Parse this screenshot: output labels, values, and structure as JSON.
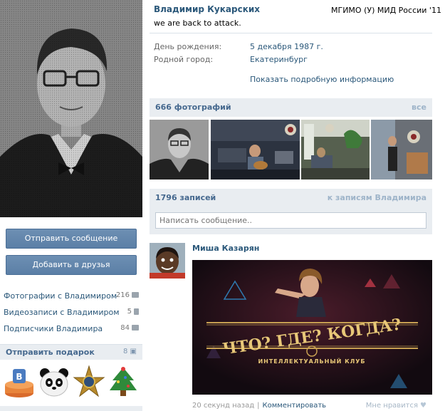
{
  "profile": {
    "name": "Владимир Кукарских",
    "university": "МГИМО (У) МИД России '11",
    "status": "we are back to attack.",
    "info": {
      "birthday_label": "День рождения:",
      "birthday_value": "5 декабря 1987 г.",
      "city_label": "Родной город:",
      "city_value": "Екатеринбург",
      "more_link": "Показать подробную информацию"
    }
  },
  "actions": {
    "send_message": "Отправить сообщение",
    "add_friend": "Добавить в друзья"
  },
  "side_links": [
    {
      "label": "Фотографии с Владимиром",
      "count": "216",
      "icon": "camera-icon"
    },
    {
      "label": "Видеозаписи с Владимиром",
      "count": "5",
      "icon": "film-icon"
    },
    {
      "label": "Подписчики Владимира",
      "count": "84",
      "icon": "users-icon"
    }
  ],
  "gifts": {
    "title": "Отправить подарок",
    "count": "8",
    "icon": "gift-icon",
    "items": [
      "vk-cake-gift",
      "panda-gift",
      "star-medal-gift",
      "christmas-tree-gift"
    ]
  },
  "photos": {
    "title": "666 фотографий",
    "all_link": "все"
  },
  "wall": {
    "title": "1796 записей",
    "all_link": "к записям Владимира",
    "compose_placeholder": "Написать сообщение.."
  },
  "post": {
    "author": "Миша Казарян",
    "time": "20 секунд назад",
    "separator": "|",
    "comment_link": "Комментировать",
    "like_label": "Мне нравится",
    "like_icon": "heart-icon",
    "image_text": {
      "headline": "ЧТО? ГДЕ? КОГДА?",
      "subline": "ИНТЕЛЛЕКТУАЛЬНЫЙ КЛУБ"
    }
  },
  "colors": {
    "link": "#2b587a",
    "header_bg": "#e9edf1",
    "button": "#5b7fa6"
  }
}
